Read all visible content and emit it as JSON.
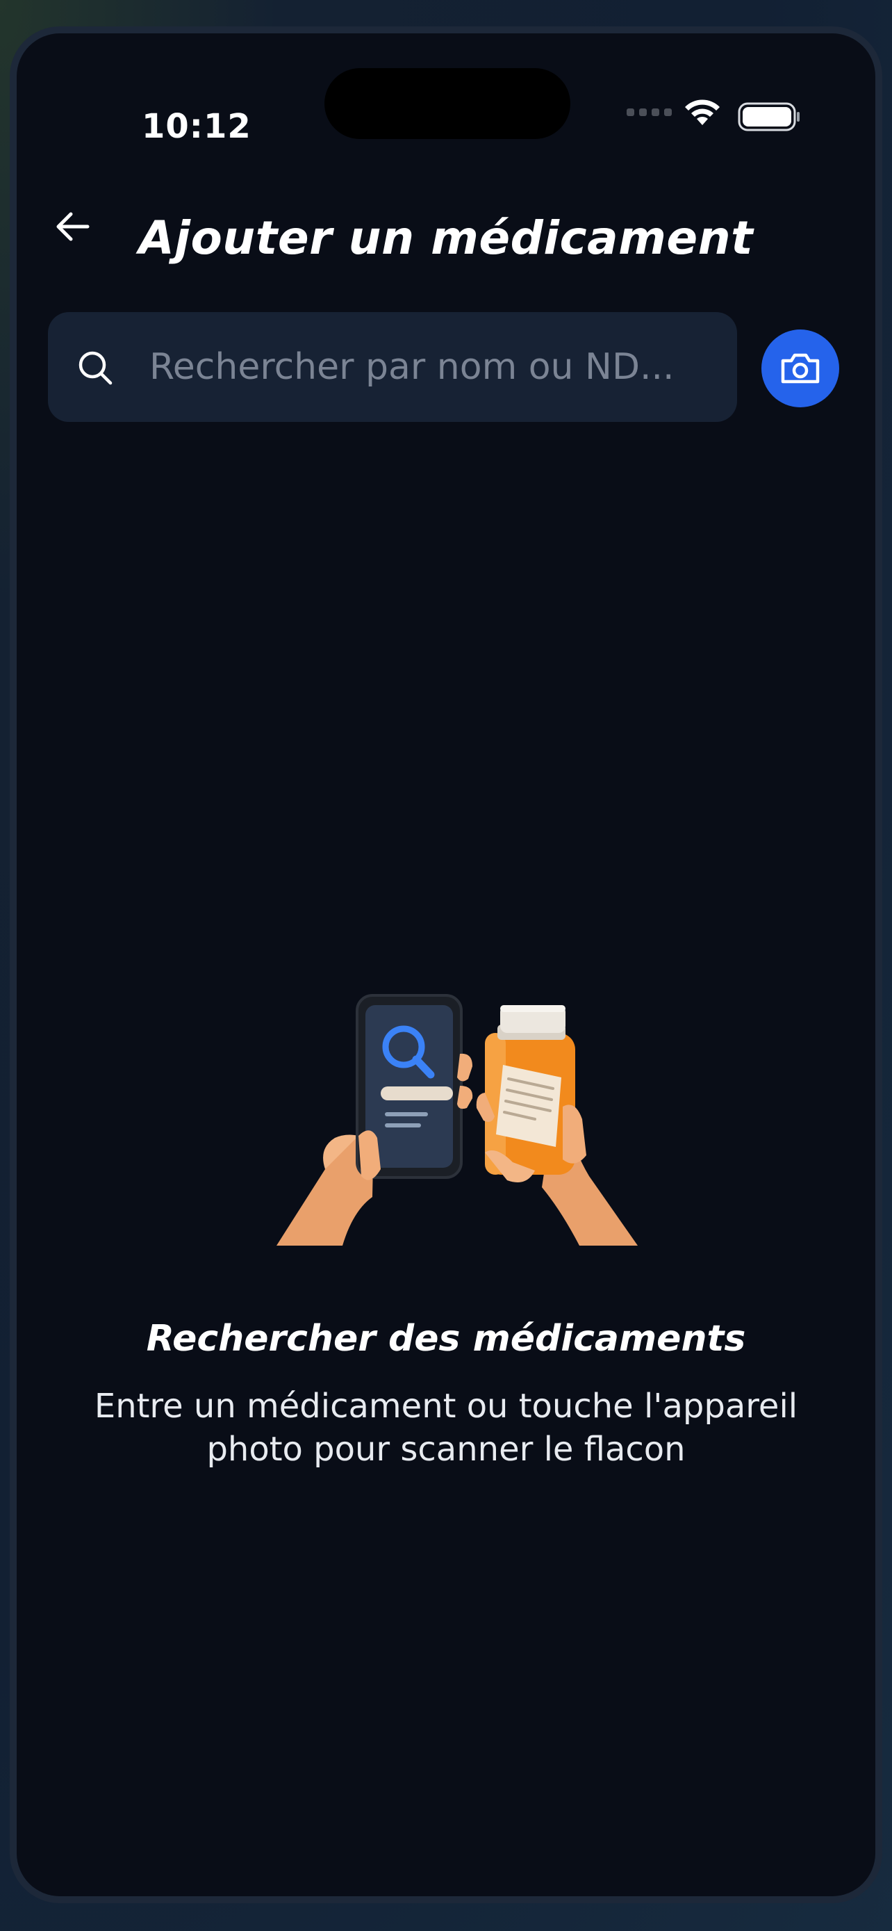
{
  "status_bar": {
    "time": "10:12"
  },
  "header": {
    "title": "Ajouter un médicament",
    "back_icon": "arrow-left-icon"
  },
  "search": {
    "placeholder": "Rechercher par nom ou ND...",
    "value": "",
    "search_icon": "search-icon",
    "camera_icon": "camera-icon"
  },
  "empty_state": {
    "illustration": "hands-phone-pill-bottle-illustration",
    "title": "Rechercher des médicaments",
    "subtitle_line1": "Entre un médicament ou touche l'appareil",
    "subtitle_line2": "photo pour scanner le flacon"
  },
  "colors": {
    "background": "#090d17",
    "search_field": "#172234",
    "accent": "#2563eb",
    "placeholder": "#7b8494"
  }
}
